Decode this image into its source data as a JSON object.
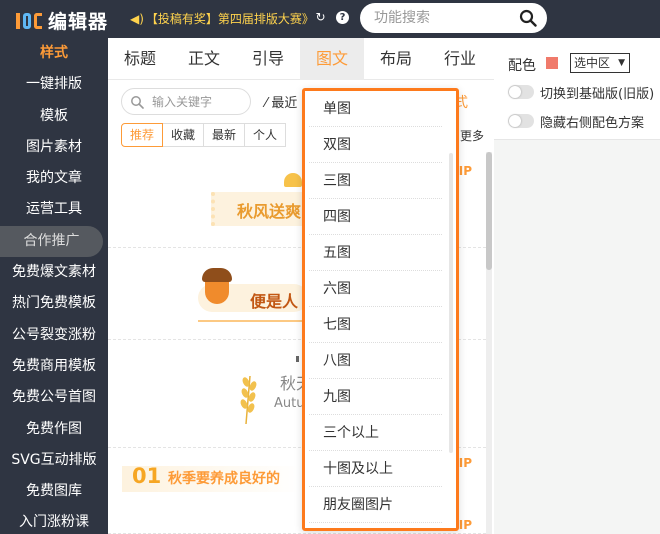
{
  "header": {
    "logo_text": "编辑器",
    "notice": "【投稿有奖】第四届排版大赛》",
    "search_placeholder": "功能搜索",
    "help_glyph": "?"
  },
  "sidebar": {
    "items": [
      {
        "label": "样式"
      },
      {
        "label": "一键排版"
      },
      {
        "label": "模板"
      },
      {
        "label": "图片素材"
      },
      {
        "label": "我的文章"
      },
      {
        "label": "运营工具"
      },
      {
        "label": "合作推广"
      },
      {
        "label": "免费爆文素材"
      },
      {
        "label": "热门免费模板"
      },
      {
        "label": "公号裂变涨粉"
      },
      {
        "label": "免费商用模板"
      },
      {
        "label": "免费公号首图"
      },
      {
        "label": "免费作图"
      },
      {
        "label": "SVG互动排版"
      },
      {
        "label": "免费图库"
      },
      {
        "label": "入门涨粉课"
      }
    ]
  },
  "tabs": [
    {
      "label": "标题"
    },
    {
      "label": "正文"
    },
    {
      "label": "引导"
    },
    {
      "label": "图文"
    },
    {
      "label": "布局"
    },
    {
      "label": "行业"
    }
  ],
  "panel": {
    "keyword_placeholder": "输入关键字",
    "recent_label": "最近",
    "orange_fragment": "式",
    "filters": [
      "推荐",
      "收藏",
      "最新",
      "个人"
    ],
    "more_label": "更多"
  },
  "templates": {
    "t1_title": "秋风送爽",
    "t2_title": "便是人",
    "t3_title": "秋天",
    "t3_subtitle": "Autu",
    "t4_num": "01",
    "t4_title": "秋季要养成良好的",
    "vip": "VIP"
  },
  "dropdown": {
    "items": [
      "单图",
      "双图",
      "三图",
      "四图",
      "五图",
      "六图",
      "七图",
      "八图",
      "九图",
      "三个以上",
      "十图及以上",
      "朋友圈图片"
    ]
  },
  "right_panel": {
    "color_label": "配色",
    "swatch_color": "#f07a6b",
    "select_value": "选中区",
    "toggle_basic": "切换到基础版(旧版)",
    "toggle_hide": "隐藏右侧配色方案"
  },
  "colors": {
    "accent": "#fd9b38",
    "dropdown_border": "#fd7a1c",
    "sidebar_bg": "#2f3542"
  }
}
